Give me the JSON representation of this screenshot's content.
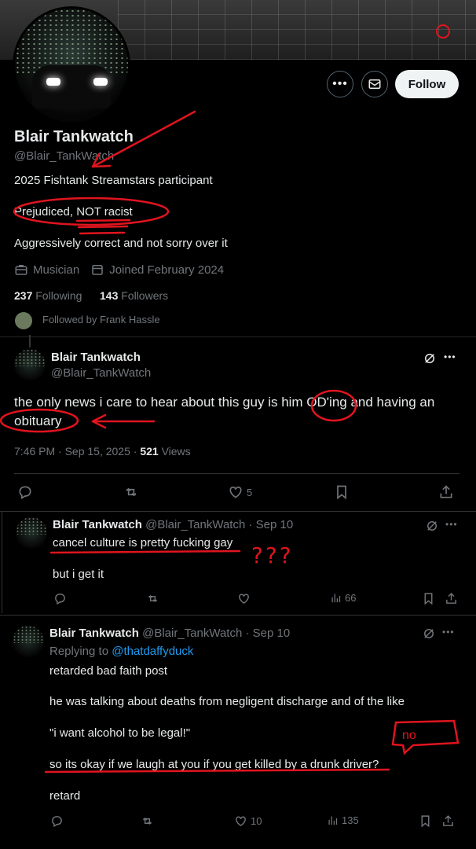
{
  "profile": {
    "display_name": "Blair Tankwatch",
    "handle": "@Blair_TankWatch",
    "follow_label": "Follow",
    "bio_lines": [
      "2025 Fishtank Streamstars participant",
      "Prejudiced, NOT racist",
      "Aggressively correct and not sorry over it"
    ],
    "profession": "Musician",
    "joined": "Joined February 2024",
    "following_count": "237",
    "following_label": "Following",
    "followers_count": "143",
    "followers_label": "Followers",
    "followed_by": "Followed by Frank Hassle"
  },
  "main_post": {
    "name": "Blair Tankwatch",
    "handle": "@Blair_TankWatch",
    "text_line1": "the only news i care to hear about this guy is him OD'ing and having an",
    "text_line2": "obituary",
    "timestamp": "7:46 PM · Sep 15, 2025 · ",
    "views_count": "521",
    "views_label": " Views",
    "likes": "5"
  },
  "reply1": {
    "name": "Blair Tankwatch",
    "handle_date": "@Blair_TankWatch · Sep 10",
    "line1": "cancel culture is pretty fucking gay",
    "line2": "but i get it",
    "views": "66"
  },
  "reply2": {
    "name": "Blair Tankwatch",
    "handle_date": "@Blair_TankWatch · Sep 10",
    "replying_prefix": "Replying to ",
    "replying_to": "@thatdaffyduck",
    "lines": [
      "retarded bad faith post",
      "he was talking about deaths from negligent discharge and of the like",
      "\"i want alcohol to be legal!\"",
      "so its okay if we laugh at you if you get killed by a drunk driver?",
      "retard"
    ],
    "likes": "10",
    "views": "135"
  },
  "annotations": {
    "question_marks": "???",
    "no_label": "no",
    "color": "#e0141e"
  },
  "icons": [
    "more-icon",
    "mail-icon",
    "briefcase-icon",
    "calendar-icon",
    "grok-icon",
    "reply-icon",
    "retweet-icon",
    "like-icon",
    "bookmark-icon",
    "share-icon",
    "views-icon"
  ]
}
